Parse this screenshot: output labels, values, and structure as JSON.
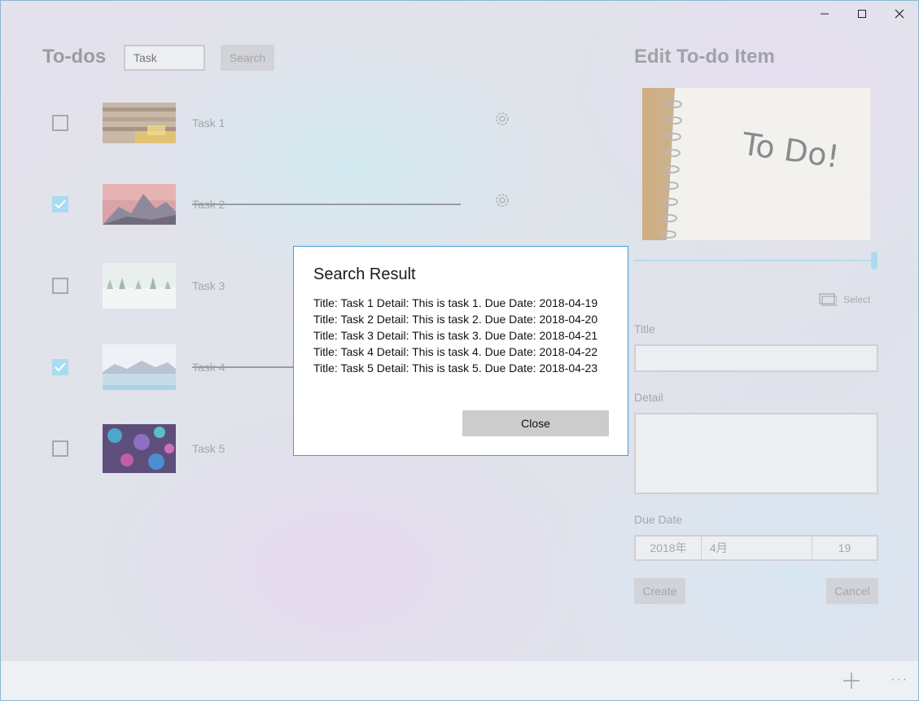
{
  "window": {
    "controls": [
      "minimize-icon",
      "maximize-icon",
      "close-icon"
    ]
  },
  "todos": {
    "title": "To-dos",
    "search_placeholder": "Task",
    "search_button": "Search",
    "items": [
      {
        "label": "Task 1",
        "checked": false,
        "has_gear": true
      },
      {
        "label": "Task 2",
        "checked": true,
        "has_gear": true
      },
      {
        "label": "Task 3",
        "checked": false,
        "has_gear": false
      },
      {
        "label": "Task 4",
        "checked": true,
        "has_gear": false
      },
      {
        "label": "Task 5",
        "checked": false,
        "has_gear": false
      }
    ]
  },
  "edit": {
    "title": "Edit To-do Item",
    "hero_text": "To Do!",
    "select_label": "Select",
    "title_label": "Title",
    "detail_label": "Detail",
    "due_date_label": "Due Date",
    "date_year": "2018年",
    "date_month": "4月",
    "date_day": "19",
    "create_button": "Create",
    "cancel_button": "Cancel"
  },
  "dialog": {
    "title": "Search Result",
    "lines": [
      "Title: Task 1 Detail: This is task 1. Due Date: 2018-04-19",
      "Title: Task 2 Detail: This is task 2. Due Date: 2018-04-20",
      "Title: Task 3 Detail: This is task 3. Due Date: 2018-04-21",
      "Title: Task 4 Detail: This is task 4. Due Date: 2018-04-22",
      "Title: Task 5 Detail: This is task 5. Due Date: 2018-04-23"
    ],
    "close_button": "Close"
  },
  "bottom_bar": {
    "add_icon": "add-icon",
    "more_label": "···"
  },
  "colors": {
    "accent": "#3c9fd9",
    "check_fill": "#a9dcf0",
    "faded_text": "#a4a6ac"
  }
}
